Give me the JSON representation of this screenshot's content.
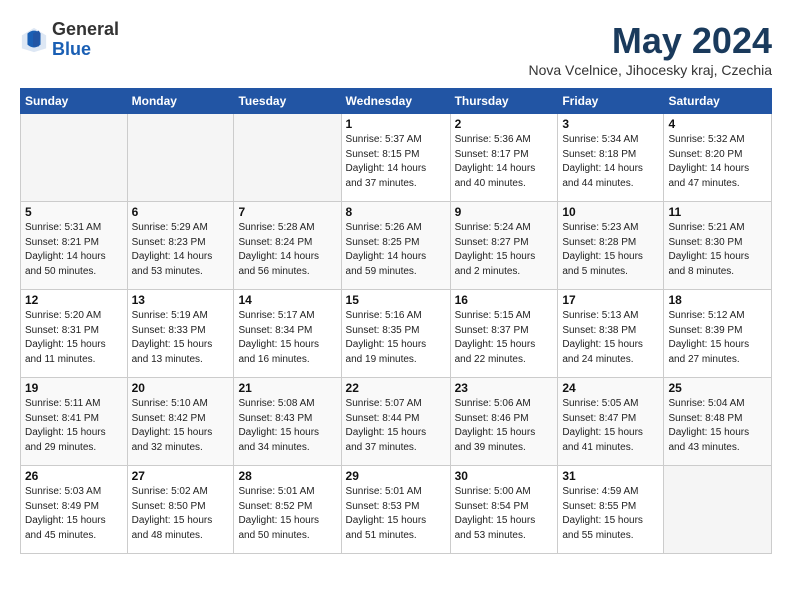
{
  "header": {
    "logo_general": "General",
    "logo_blue": "Blue",
    "month_title": "May 2024",
    "location": "Nova Vcelnice, Jihocesky kraj, Czechia"
  },
  "weekdays": [
    "Sunday",
    "Monday",
    "Tuesday",
    "Wednesday",
    "Thursday",
    "Friday",
    "Saturday"
  ],
  "weeks": [
    [
      {
        "num": "",
        "info": ""
      },
      {
        "num": "",
        "info": ""
      },
      {
        "num": "",
        "info": ""
      },
      {
        "num": "1",
        "info": "Sunrise: 5:37 AM\nSunset: 8:15 PM\nDaylight: 14 hours\nand 37 minutes."
      },
      {
        "num": "2",
        "info": "Sunrise: 5:36 AM\nSunset: 8:17 PM\nDaylight: 14 hours\nand 40 minutes."
      },
      {
        "num": "3",
        "info": "Sunrise: 5:34 AM\nSunset: 8:18 PM\nDaylight: 14 hours\nand 44 minutes."
      },
      {
        "num": "4",
        "info": "Sunrise: 5:32 AM\nSunset: 8:20 PM\nDaylight: 14 hours\nand 47 minutes."
      }
    ],
    [
      {
        "num": "5",
        "info": "Sunrise: 5:31 AM\nSunset: 8:21 PM\nDaylight: 14 hours\nand 50 minutes."
      },
      {
        "num": "6",
        "info": "Sunrise: 5:29 AM\nSunset: 8:23 PM\nDaylight: 14 hours\nand 53 minutes."
      },
      {
        "num": "7",
        "info": "Sunrise: 5:28 AM\nSunset: 8:24 PM\nDaylight: 14 hours\nand 56 minutes."
      },
      {
        "num": "8",
        "info": "Sunrise: 5:26 AM\nSunset: 8:25 PM\nDaylight: 14 hours\nand 59 minutes."
      },
      {
        "num": "9",
        "info": "Sunrise: 5:24 AM\nSunset: 8:27 PM\nDaylight: 15 hours\nand 2 minutes."
      },
      {
        "num": "10",
        "info": "Sunrise: 5:23 AM\nSunset: 8:28 PM\nDaylight: 15 hours\nand 5 minutes."
      },
      {
        "num": "11",
        "info": "Sunrise: 5:21 AM\nSunset: 8:30 PM\nDaylight: 15 hours\nand 8 minutes."
      }
    ],
    [
      {
        "num": "12",
        "info": "Sunrise: 5:20 AM\nSunset: 8:31 PM\nDaylight: 15 hours\nand 11 minutes."
      },
      {
        "num": "13",
        "info": "Sunrise: 5:19 AM\nSunset: 8:33 PM\nDaylight: 15 hours\nand 13 minutes."
      },
      {
        "num": "14",
        "info": "Sunrise: 5:17 AM\nSunset: 8:34 PM\nDaylight: 15 hours\nand 16 minutes."
      },
      {
        "num": "15",
        "info": "Sunrise: 5:16 AM\nSunset: 8:35 PM\nDaylight: 15 hours\nand 19 minutes."
      },
      {
        "num": "16",
        "info": "Sunrise: 5:15 AM\nSunset: 8:37 PM\nDaylight: 15 hours\nand 22 minutes."
      },
      {
        "num": "17",
        "info": "Sunrise: 5:13 AM\nSunset: 8:38 PM\nDaylight: 15 hours\nand 24 minutes."
      },
      {
        "num": "18",
        "info": "Sunrise: 5:12 AM\nSunset: 8:39 PM\nDaylight: 15 hours\nand 27 minutes."
      }
    ],
    [
      {
        "num": "19",
        "info": "Sunrise: 5:11 AM\nSunset: 8:41 PM\nDaylight: 15 hours\nand 29 minutes."
      },
      {
        "num": "20",
        "info": "Sunrise: 5:10 AM\nSunset: 8:42 PM\nDaylight: 15 hours\nand 32 minutes."
      },
      {
        "num": "21",
        "info": "Sunrise: 5:08 AM\nSunset: 8:43 PM\nDaylight: 15 hours\nand 34 minutes."
      },
      {
        "num": "22",
        "info": "Sunrise: 5:07 AM\nSunset: 8:44 PM\nDaylight: 15 hours\nand 37 minutes."
      },
      {
        "num": "23",
        "info": "Sunrise: 5:06 AM\nSunset: 8:46 PM\nDaylight: 15 hours\nand 39 minutes."
      },
      {
        "num": "24",
        "info": "Sunrise: 5:05 AM\nSunset: 8:47 PM\nDaylight: 15 hours\nand 41 minutes."
      },
      {
        "num": "25",
        "info": "Sunrise: 5:04 AM\nSunset: 8:48 PM\nDaylight: 15 hours\nand 43 minutes."
      }
    ],
    [
      {
        "num": "26",
        "info": "Sunrise: 5:03 AM\nSunset: 8:49 PM\nDaylight: 15 hours\nand 45 minutes."
      },
      {
        "num": "27",
        "info": "Sunrise: 5:02 AM\nSunset: 8:50 PM\nDaylight: 15 hours\nand 48 minutes."
      },
      {
        "num": "28",
        "info": "Sunrise: 5:01 AM\nSunset: 8:52 PM\nDaylight: 15 hours\nand 50 minutes."
      },
      {
        "num": "29",
        "info": "Sunrise: 5:01 AM\nSunset: 8:53 PM\nDaylight: 15 hours\nand 51 minutes."
      },
      {
        "num": "30",
        "info": "Sunrise: 5:00 AM\nSunset: 8:54 PM\nDaylight: 15 hours\nand 53 minutes."
      },
      {
        "num": "31",
        "info": "Sunrise: 4:59 AM\nSunset: 8:55 PM\nDaylight: 15 hours\nand 55 minutes."
      },
      {
        "num": "",
        "info": ""
      }
    ]
  ]
}
